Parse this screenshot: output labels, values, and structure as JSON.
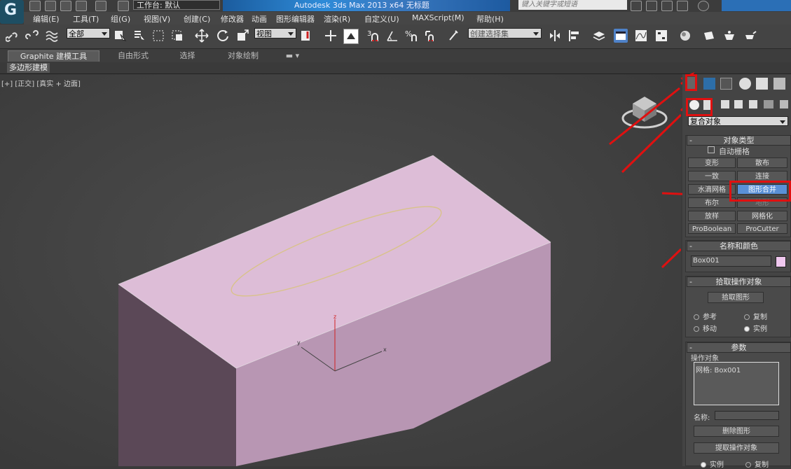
{
  "titlebar": {
    "workspace_label": "工作台: 默认",
    "app_title": "Autodesk 3ds Max  2013 x64      无标题",
    "search_placeholder": "键入关键字或短语"
  },
  "menu": [
    "编辑(E)",
    "工具(T)",
    "组(G)",
    "视图(V)",
    "创建(C)",
    "修改器",
    "动画",
    "图形编辑器",
    "渲染(R)",
    "自定义(U)",
    "MAXScript(M)",
    "帮助(H)"
  ],
  "toolbar": {
    "selection_filter": "全部",
    "ref_coord": "视图",
    "named_selection": "创建选择集",
    "snap_labels": [
      "3",
      "%"
    ]
  },
  "ribbon": {
    "tabs": [
      "Graphite 建模工具",
      "自由形式",
      "选择",
      "对象绘制"
    ],
    "subtab": "多边形建模"
  },
  "viewport": {
    "label": "[+] [正交] [真实 + 边面]",
    "axis_x": "x",
    "axis_y": "y",
    "axis_z": "z",
    "colors": {
      "box_top": "#ddbdd7",
      "box_front": "#b896b3",
      "box_side": "#5b4857",
      "ellipse": "#d9c28a"
    }
  },
  "panel": {
    "category_dropdown": "复合对象",
    "object_type": {
      "header": "对象类型",
      "autogrid_label": "自动栅格",
      "buttons": [
        "变形",
        "散布",
        "一致",
        "连接",
        "水滴网格",
        "图形合并",
        "布尔",
        "地形",
        "放样",
        "网格化",
        "ProBoolean",
        "ProCutter"
      ],
      "active": "图形合并"
    },
    "name_color": {
      "header": "名称和颜色",
      "name_value": "Box001",
      "swatch": "#f0c8ef"
    },
    "pick_operand": {
      "header": "拾取操作对象",
      "pick_button": "拾取图形",
      "radios": [
        {
          "label": "参考",
          "checked": false
        },
        {
          "label": "复制",
          "checked": false
        },
        {
          "label": "移动",
          "checked": false
        },
        {
          "label": "实例",
          "checked": true
        }
      ]
    },
    "parameters": {
      "header": "参数",
      "operands_label": "操作对象",
      "operand_item": "网格: Box001",
      "name_label": "名称:",
      "delete_button": "删除图形",
      "extract_button": "提取操作对象",
      "extract_radios": [
        {
          "label": "实例",
          "checked": true
        },
        {
          "label": "复制",
          "checked": false
        }
      ]
    }
  },
  "annotation_color": "#e01010"
}
